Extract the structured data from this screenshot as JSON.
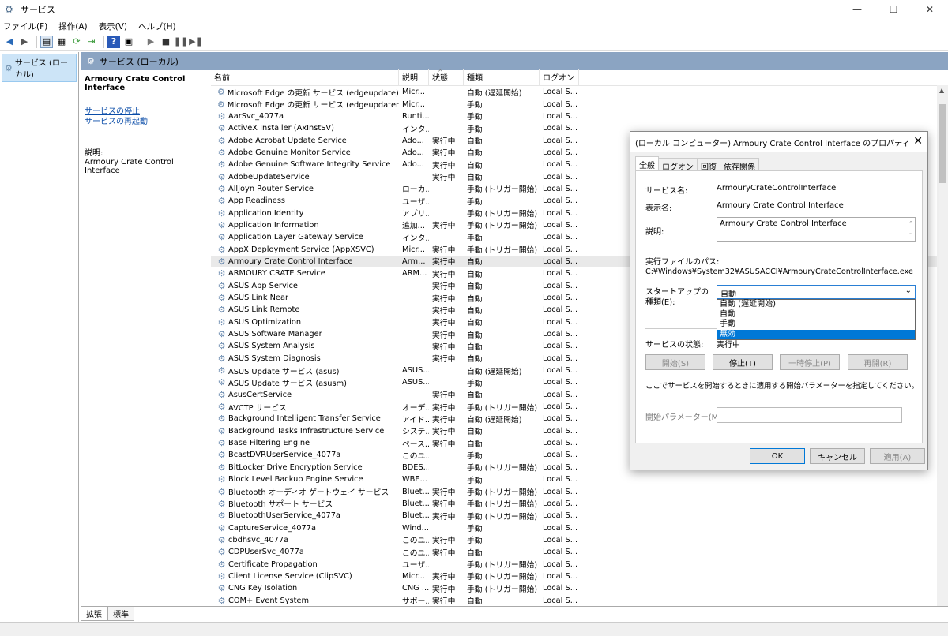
{
  "window": {
    "title": "サービス",
    "minimize": "—",
    "maximize": "☐",
    "close": "✕"
  },
  "menu": [
    "ファイル(F)",
    "操作(A)",
    "表示(V)",
    "ヘルプ(H)"
  ],
  "tree": {
    "root_label": "サービス (ローカル)"
  },
  "main": {
    "header": "サービス (ローカル)"
  },
  "leftpane": {
    "service_title": "Armoury Crate Control Interface",
    "stop_link": "サービスの停止",
    "restart_link": "サービスの再起動",
    "desc_label": "説明:",
    "desc_value": "Armoury Crate Control Interface"
  },
  "columns": {
    "name": "名前",
    "desc": "説明",
    "state": "状態",
    "startup": "スタートアップの種類",
    "logon": "ログオン"
  },
  "services": [
    {
      "name": "Microsoft Edge の更新 サービス (edgeupdate)",
      "desc": "Micr...",
      "state": "",
      "startup": "自動 (遅延開始)",
      "logon": "Local S..."
    },
    {
      "name": "Microsoft Edge の更新 サービス (edgeupdatem)",
      "desc": "Micr...",
      "state": "",
      "startup": "手動",
      "logon": "Local S..."
    },
    {
      "name": "AarSvc_4077a",
      "desc": "Runti...",
      "state": "",
      "startup": "手動",
      "logon": "Local S..."
    },
    {
      "name": "ActiveX Installer (AxInstSV)",
      "desc": "インタ...",
      "state": "",
      "startup": "手動",
      "logon": "Local S..."
    },
    {
      "name": "Adobe Acrobat Update Service",
      "desc": "Ado...",
      "state": "実行中",
      "startup": "自動",
      "logon": "Local S..."
    },
    {
      "name": "Adobe Genuine Monitor Service",
      "desc": "Ado...",
      "state": "実行中",
      "startup": "自動",
      "logon": "Local S..."
    },
    {
      "name": "Adobe Genuine Software Integrity Service",
      "desc": "Ado...",
      "state": "実行中",
      "startup": "自動",
      "logon": "Local S..."
    },
    {
      "name": "AdobeUpdateService",
      "desc": "",
      "state": "実行中",
      "startup": "自動",
      "logon": "Local S..."
    },
    {
      "name": "AllJoyn Router Service",
      "desc": "ローカ...",
      "state": "",
      "startup": "手動 (トリガー開始)",
      "logon": "Local S..."
    },
    {
      "name": "App Readiness",
      "desc": "ユーザ...",
      "state": "",
      "startup": "手動",
      "logon": "Local S..."
    },
    {
      "name": "Application Identity",
      "desc": "アプリ...",
      "state": "",
      "startup": "手動 (トリガー開始)",
      "logon": "Local S..."
    },
    {
      "name": "Application Information",
      "desc": "追加...",
      "state": "実行中",
      "startup": "手動 (トリガー開始)",
      "logon": "Local S..."
    },
    {
      "name": "Application Layer Gateway Service",
      "desc": "インタ...",
      "state": "",
      "startup": "手動",
      "logon": "Local S..."
    },
    {
      "name": "AppX Deployment Service (AppXSVC)",
      "desc": "Micr...",
      "state": "実行中",
      "startup": "手動 (トリガー開始)",
      "logon": "Local S..."
    },
    {
      "name": "Armoury Crate Control Interface",
      "desc": "Arm...",
      "state": "実行中",
      "startup": "自動",
      "logon": "Local S...",
      "mark": true,
      "selected": true
    },
    {
      "name": "ARMOURY CRATE Service",
      "desc": "ARM...",
      "state": "実行中",
      "startup": "自動",
      "logon": "Local S...",
      "mark": true
    },
    {
      "name": "ASUS App Service",
      "desc": "",
      "state": "実行中",
      "startup": "自動",
      "logon": "Local S..."
    },
    {
      "name": "ASUS Link Near",
      "desc": "",
      "state": "実行中",
      "startup": "自動",
      "logon": "Local S..."
    },
    {
      "name": "ASUS Link Remote",
      "desc": "",
      "state": "実行中",
      "startup": "自動",
      "logon": "Local S..."
    },
    {
      "name": "ASUS Optimization",
      "desc": "",
      "state": "実行中",
      "startup": "自動",
      "logon": "Local S..."
    },
    {
      "name": "ASUS Software Manager",
      "desc": "",
      "state": "実行中",
      "startup": "自動",
      "logon": "Local S..."
    },
    {
      "name": "ASUS System Analysis",
      "desc": "",
      "state": "実行中",
      "startup": "自動",
      "logon": "Local S..."
    },
    {
      "name": "ASUS System Diagnosis",
      "desc": "",
      "state": "実行中",
      "startup": "自動",
      "logon": "Local S..."
    },
    {
      "name": "ASUS Update サービス (asus)",
      "desc": "ASUS...",
      "state": "",
      "startup": "自動 (遅延開始)",
      "logon": "Local S..."
    },
    {
      "name": "ASUS Update サービス (asusm)",
      "desc": "ASUS...",
      "state": "",
      "startup": "手動",
      "logon": "Local S..."
    },
    {
      "name": "AsusCertService",
      "desc": "",
      "state": "実行中",
      "startup": "自動",
      "logon": "Local S..."
    },
    {
      "name": "AVCTP サービス",
      "desc": "オーデ...",
      "state": "実行中",
      "startup": "手動 (トリガー開始)",
      "logon": "Local S..."
    },
    {
      "name": "Background Intelligent Transfer Service",
      "desc": "アイド...",
      "state": "実行中",
      "startup": "自動 (遅延開始)",
      "logon": "Local S..."
    },
    {
      "name": "Background Tasks Infrastructure Service",
      "desc": "システ...",
      "state": "実行中",
      "startup": "自動",
      "logon": "Local S..."
    },
    {
      "name": "Base Filtering Engine",
      "desc": "ベース...",
      "state": "実行中",
      "startup": "自動",
      "logon": "Local S..."
    },
    {
      "name": "BcastDVRUserService_4077a",
      "desc": "このユ...",
      "state": "",
      "startup": "手動",
      "logon": "Local S..."
    },
    {
      "name": "BitLocker Drive Encryption Service",
      "desc": "BDES...",
      "state": "",
      "startup": "手動 (トリガー開始)",
      "logon": "Local S..."
    },
    {
      "name": "Block Level Backup Engine Service",
      "desc": "WBE...",
      "state": "",
      "startup": "手動",
      "logon": "Local S..."
    },
    {
      "name": "Bluetooth オーディオ ゲートウェイ サービス",
      "desc": "Bluet...",
      "state": "実行中",
      "startup": "手動 (トリガー開始)",
      "logon": "Local S..."
    },
    {
      "name": "Bluetooth サポート サービス",
      "desc": "Bluet...",
      "state": "実行中",
      "startup": "手動 (トリガー開始)",
      "logon": "Local S..."
    },
    {
      "name": "BluetoothUserService_4077a",
      "desc": "Bluet...",
      "state": "実行中",
      "startup": "手動 (トリガー開始)",
      "logon": "Local S..."
    },
    {
      "name": "CaptureService_4077a",
      "desc": "Wind...",
      "state": "",
      "startup": "手動",
      "logon": "Local S..."
    },
    {
      "name": "cbdhsvc_4077a",
      "desc": "このユ...",
      "state": "実行中",
      "startup": "手動",
      "logon": "Local S..."
    },
    {
      "name": "CDPUserSvc_4077a",
      "desc": "このユ...",
      "state": "実行中",
      "startup": "自動",
      "logon": "Local S..."
    },
    {
      "name": "Certificate Propagation",
      "desc": "ユーザ...",
      "state": "",
      "startup": "手動 (トリガー開始)",
      "logon": "Local S..."
    },
    {
      "name": "Client License Service (ClipSVC)",
      "desc": "Micr...",
      "state": "実行中",
      "startup": "手動 (トリガー開始)",
      "logon": "Local S..."
    },
    {
      "name": "CNG Key Isolation",
      "desc": "CNG ...",
      "state": "実行中",
      "startup": "手動 (トリガー開始)",
      "logon": "Local S..."
    },
    {
      "name": "COM+ Event System",
      "desc": "サポー...",
      "state": "実行中",
      "startup": "自動",
      "logon": "Local S..."
    }
  ],
  "bottom_tabs": [
    "拡張",
    "標準"
  ],
  "dialog": {
    "title": "(ローカル コンピューター) Armoury Crate Control Interface のプロパティ",
    "close": "✕",
    "tabs": [
      "全般",
      "ログオン",
      "回復",
      "依存関係"
    ],
    "service_name_label": "サービス名:",
    "service_name": "ArmouryCrateControlInterface",
    "display_name_label": "表示名:",
    "display_name": "Armoury Crate Control Interface",
    "description_label": "説明:",
    "description": "Armoury Crate Control Interface",
    "exe_path_label": "実行ファイルのパス:",
    "exe_path": "C:¥Windows¥System32¥ASUSACCI¥ArmouryCrateControlInterface.exe",
    "startup_type_label_1": "スタートアップの",
    "startup_type_label_2": "種類(E):",
    "startup_type_value": "自動",
    "startup_options": [
      "自動 (遅延開始)",
      "自動",
      "手動",
      "無効"
    ],
    "startup_selected_index": 3,
    "status_label": "サービスの状態:",
    "status_value": "実行中",
    "btn_start": "開始(S)",
    "btn_stop": "停止(T)",
    "btn_pause": "一時停止(P)",
    "btn_resume": "再開(R)",
    "hint": "ここでサービスを開始するときに適用する開始パラメーターを指定してください。",
    "param_label": "開始パラメーター(M):",
    "btn_ok": "OK",
    "btn_cancel": "キャンセル",
    "btn_apply": "適用(A)"
  }
}
